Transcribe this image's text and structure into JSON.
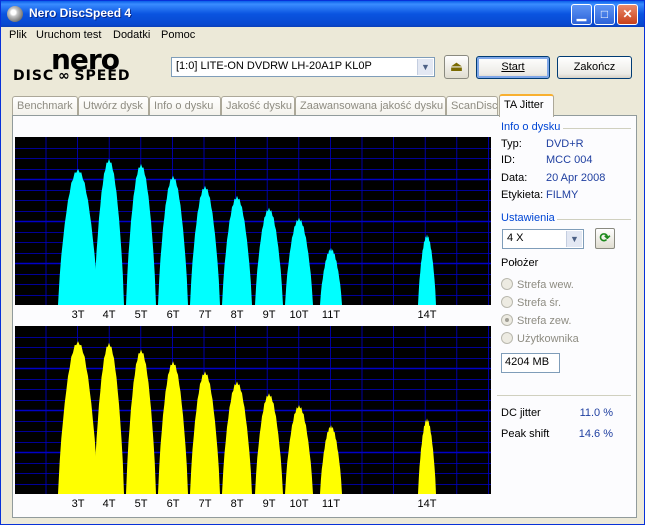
{
  "window": {
    "title": "Nero DiscSpeed 4",
    "buttons": {
      "minimize": "▁",
      "maximize": "□",
      "close": "✕"
    }
  },
  "menu": [
    "Plik",
    "Uruchom test",
    "Dodatki",
    "Pomoc"
  ],
  "logo": {
    "top": "nero",
    "bottom": "DISC ∞ SPEED"
  },
  "toolbar": {
    "drive": "[1:0]   LITE-ON DVDRW LH-20A1P KL0P",
    "start_label": "Start",
    "exit_label": "Zakończ"
  },
  "tabs": [
    "Benchmark",
    "Utwórz dysk",
    "Info o dysku",
    "Jakość dysku",
    "Zaawansowana jakość dysku",
    "ScanDisc",
    "TA Jitter"
  ],
  "active_tab": "TA Jitter",
  "disc_info": {
    "title": "Info o dysku",
    "rows": [
      {
        "key": "Typ:",
        "value": "DVD+R"
      },
      {
        "key": "ID:",
        "value": "MCC 004"
      },
      {
        "key": "Data:",
        "value": "20 Apr 2008"
      },
      {
        "key": "Etykieta:",
        "value": "FILMY"
      }
    ]
  },
  "settings": {
    "title": "Ustawienia",
    "speed": "4 X",
    "position_label": "Położer",
    "options": [
      "Strefa wew.",
      "Strefa śr.",
      "Strefa zew.",
      "Użytkownika"
    ],
    "selected_option": "Strefa zew.",
    "user_position": "4204 MB"
  },
  "results": {
    "dc_jitter_label": "DC jitter",
    "dc_jitter_value": "11.0 %",
    "peak_shift_label": "Peak shift",
    "peak_shift_value": "14.6 %"
  },
  "colors": {
    "chart_bg": "#000000",
    "grid": "#0000C8",
    "top_series": "#00FFFF",
    "bottom_series": "#FFFF00",
    "accent_text": "#0046D5"
  },
  "chart_data": [
    {
      "type": "area",
      "tick_labels": [
        "3T",
        "4T",
        "5T",
        "6T",
        "7T",
        "8T",
        "9T",
        "10T",
        "11T",
        "14T"
      ],
      "peak_values": [
        0.81,
        0.87,
        0.84,
        0.77,
        0.71,
        0.65,
        0.58,
        0.52,
        0.34,
        0.42
      ],
      "grid": true,
      "series_color": "#00FFFF"
    },
    {
      "type": "area",
      "tick_labels": [
        "3T",
        "4T",
        "5T",
        "6T",
        "7T",
        "8T",
        "9T",
        "10T",
        "11T",
        "14T"
      ],
      "peak_values": [
        0.91,
        0.9,
        0.86,
        0.79,
        0.73,
        0.67,
        0.6,
        0.53,
        0.41,
        0.45
      ],
      "grid": true,
      "series_color": "#FFFF00"
    }
  ]
}
